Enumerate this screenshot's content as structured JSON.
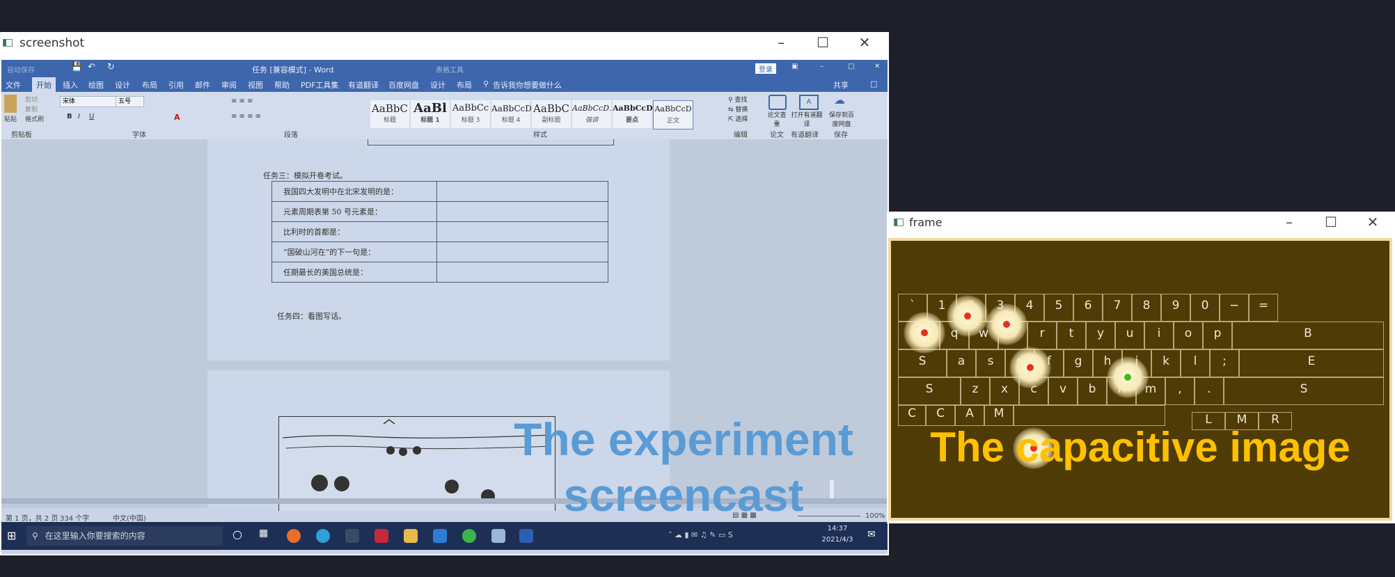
{
  "window_screenshot": {
    "title": "screenshot"
  },
  "window_frame": {
    "title": "frame"
  },
  "word": {
    "quick_access": "自动保存",
    "doc_title": "任务 [兼容模式] - Word",
    "table_tools": "表格工具",
    "login": "登录",
    "tabs": [
      "文件",
      "开始",
      "插入",
      "绘图",
      "设计",
      "布局",
      "引用",
      "邮件",
      "审阅",
      "视图",
      "帮助",
      "PDF工具集",
      "有道翻译",
      "百度网盘",
      "设计",
      "布局"
    ],
    "tell_me": "告诉我你想要做什么",
    "share": "共享",
    "clipboard": {
      "paste": "粘贴",
      "cut": "剪切",
      "copy": "复制",
      "format_painter": "格式刷",
      "label": "剪贴板"
    },
    "font": {
      "name": "宋体",
      "size": "五号",
      "label": "字体"
    },
    "paragraph_label": "段落",
    "styles_label": "样式",
    "styles": [
      {
        "sample": "AaBbC",
        "name": "标题"
      },
      {
        "sample": "AaBl",
        "name": "标题 1"
      },
      {
        "sample": "AaBbCc",
        "name": "标题 3"
      },
      {
        "sample": "AaBbCcD",
        "name": "标题 4"
      },
      {
        "sample": "AaBbC",
        "name": "副标题"
      },
      {
        "sample": "AaBbCcD.",
        "name": "强调"
      },
      {
        "sample": "AaBbCcD",
        "name": "要点"
      },
      {
        "sample": "AaBbCcD",
        "name": "正文"
      }
    ],
    "editing": {
      "find": "查找",
      "replace": "替换",
      "select": "选择",
      "label": "编辑"
    },
    "review_group": {
      "btn": "论文查重",
      "label": "论文"
    },
    "youdao": {
      "btn": "打开有道翻译",
      "label": "有道翻译"
    },
    "baidu": {
      "btn": "保存到百度网盘",
      "label": "保存"
    },
    "task3": "任务三：模拟开卷考试。",
    "rows": [
      "我国四大发明中在北宋发明的是：",
      "元素周期表第 50 号元素是：",
      "比利时的首都是：",
      "“国破山河在”的下一句是：",
      "任期最长的美国总统是："
    ],
    "task4": "任务四：看图写话。",
    "status": {
      "page": "第 1 页，共 2 页",
      "words": "334 个字",
      "lang": "中文(中国)",
      "zoom": "100%"
    }
  },
  "taskbar": {
    "search_placeholder": "在这里输入你要搜索的内容",
    "time": "14:37",
    "date": "2021/4/3"
  },
  "overlays": {
    "left": "The experiment\nscreencast",
    "right": "The capacitive image"
  },
  "keyboard": {
    "row1": [
      "`",
      "1",
      "2",
      "3",
      "4",
      "5",
      "6",
      "7",
      "8",
      "9",
      "0",
      "−",
      "="
    ],
    "row2": [
      "T",
      "q",
      "w",
      "e",
      "r",
      "t",
      "y",
      "u",
      "i",
      "o",
      "p",
      "B"
    ],
    "row3": [
      "S",
      "a",
      "s",
      "d",
      "f",
      "g",
      "h",
      "j",
      "k",
      "l",
      ";",
      "E"
    ],
    "row4": [
      "S",
      "z",
      "x",
      "c",
      "v",
      "b",
      "n",
      "m",
      ",",
      ".",
      "S"
    ],
    "row5": [
      "C",
      "C",
      "A",
      "M"
    ],
    "row5_right": [
      "L",
      "M",
      "R"
    ]
  },
  "colors": {
    "overlay_left": "#5b9bd5",
    "overlay_right": "#ffc000",
    "touch_red": "#e8311b",
    "touch_green": "#35c01d",
    "frame_bg": "#4f3b06",
    "word_blue": "#3d66ad"
  }
}
